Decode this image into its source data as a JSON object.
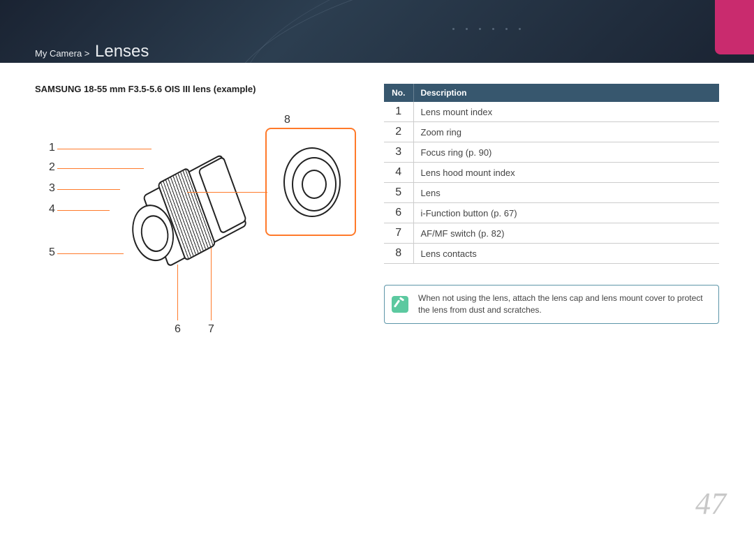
{
  "breadcrumb": {
    "path": "My Camera >",
    "title": "Lenses"
  },
  "subtitle": "SAMSUNG 18-55 mm F3.5-5.6 OIS III lens (example)",
  "callouts": {
    "n1": "1",
    "n2": "2",
    "n3": "3",
    "n4": "4",
    "n5": "5",
    "n6": "6",
    "n7": "7",
    "n8": "8"
  },
  "table": {
    "headers": {
      "no": "No.",
      "desc": "Description"
    },
    "rows": [
      {
        "no": "1",
        "desc": "Lens mount index"
      },
      {
        "no": "2",
        "desc": "Zoom ring"
      },
      {
        "no": "3",
        "desc": "Focus ring (p. 90)"
      },
      {
        "no": "4",
        "desc": "Lens hood mount index"
      },
      {
        "no": "5",
        "desc": "Lens"
      },
      {
        "no": "6",
        "desc": "i-Function button (p. 67)"
      },
      {
        "no": "7",
        "desc": "AF/MF switch (p. 82)"
      },
      {
        "no": "8",
        "desc": "Lens contacts"
      }
    ]
  },
  "note": "When not using the lens, attach the lens cap and lens mount cover to protect the lens from dust and scratches.",
  "page_number": "47"
}
